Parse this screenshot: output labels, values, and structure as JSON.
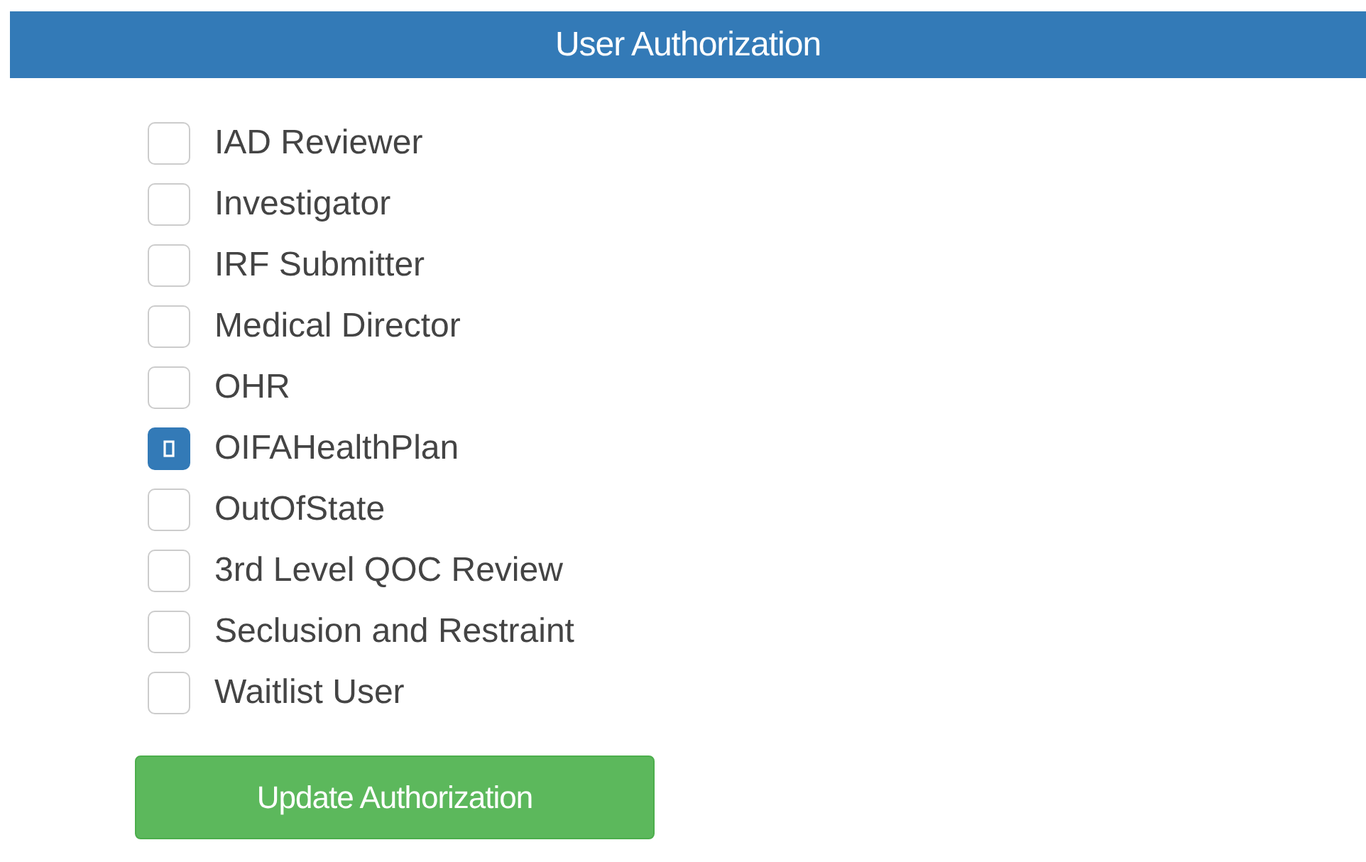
{
  "header": {
    "title": "User Authorization"
  },
  "roles": [
    {
      "label": "IAD Reviewer",
      "checked": false
    },
    {
      "label": "Investigator",
      "checked": false
    },
    {
      "label": "IRF Submitter",
      "checked": false
    },
    {
      "label": "Medical Director",
      "checked": false
    },
    {
      "label": "OHR",
      "checked": false
    },
    {
      "label": "OIFAHealthPlan",
      "checked": true
    },
    {
      "label": "OutOfState",
      "checked": false
    },
    {
      "label": "3rd Level QOC Review",
      "checked": false
    },
    {
      "label": "Seclusion and Restraint",
      "checked": false
    },
    {
      "label": "Waitlist User",
      "checked": false
    }
  ],
  "button": {
    "label": "Update Authorization"
  }
}
